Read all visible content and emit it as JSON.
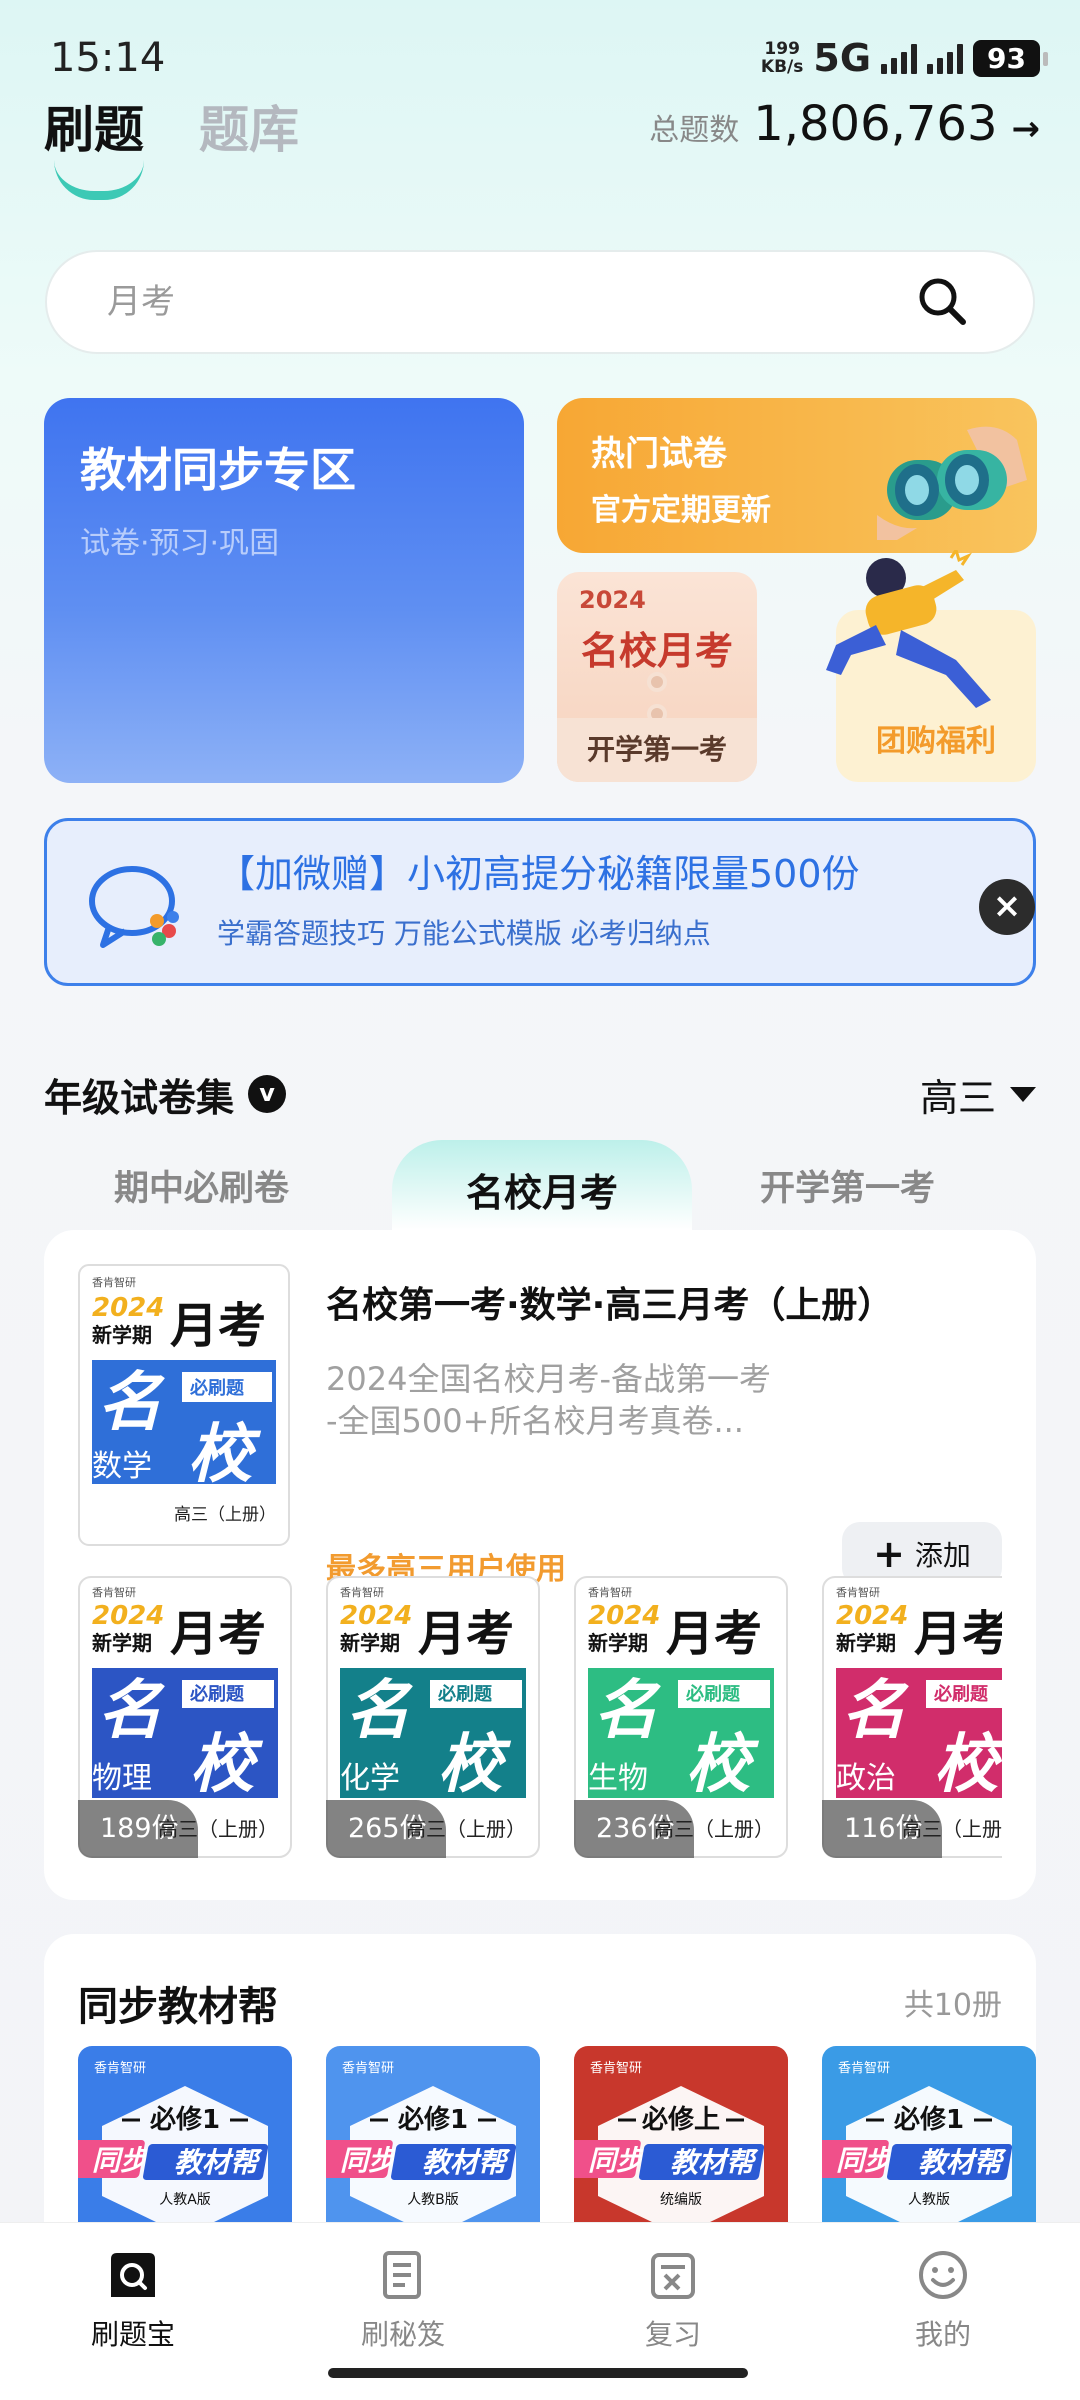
{
  "status_bar": {
    "time": "15:14",
    "net_speed_value": "199",
    "net_speed_unit": "KB/s",
    "network": "5G",
    "battery": "93"
  },
  "header": {
    "tab_active": "刷题",
    "tab_inactive": "题库",
    "total_label": "总题数",
    "total_value": "1,806,763",
    "arrow": "→"
  },
  "search": {
    "placeholder": "月考",
    "icon": "search-icon"
  },
  "features": {
    "sync": {
      "title": "教材同步专区",
      "subtitle": "试卷·预习·巩固"
    },
    "hot": {
      "title": "热门试卷",
      "subtitle": "官方定期更新"
    },
    "exam": {
      "year": "2024",
      "title": "名校月考",
      "bottom": "开学第一考"
    },
    "group": {
      "label": "团购福利"
    }
  },
  "promo": {
    "title": "【加微赠】小初高提分秘籍限量500份",
    "subtitle": "学霸答题技巧  万能公式模版  必考归纳点",
    "close": "×"
  },
  "grade_section": {
    "title": "年级试卷集",
    "badge": "v",
    "grade": "高三",
    "tabs": [
      "期中必刷卷",
      "名校月考",
      "开学第一考"
    ],
    "active_tab": 1,
    "featured": {
      "title": "名校第一考·数学·高三月考（上册）",
      "desc_line1": "2024全国名校月考-备战第一考",
      "desc_line2": "-全国500+所名校月考真卷...",
      "usage": "最多高三用户使用",
      "add_label": "添加",
      "add_icon": "+",
      "cover": {
        "brand": "香肯智研",
        "year": "2024",
        "term": "新学期",
        "kind": "月考",
        "big1": "名",
        "big2": "校",
        "stamp": "必刷题",
        "subject": "数学",
        "edition": "高三（上册）",
        "color": "#2f6fd8"
      }
    },
    "books": [
      {
        "subject": "物理",
        "count": "189份",
        "edition": "高三（上册）",
        "color": "#2c55c4"
      },
      {
        "subject": "化学",
        "count": "265份",
        "edition": "高三（上册）",
        "color": "#13808a"
      },
      {
        "subject": "生物",
        "count": "236份",
        "edition": "高三（上册）",
        "color": "#2dbd83"
      },
      {
        "subject": "政治",
        "count": "116份",
        "edition": "高三（上册）",
        "color": "#d12d6b"
      }
    ]
  },
  "textbook_section": {
    "title": "同步教材帮",
    "count": "共10册",
    "books": [
      {
        "brand": "香肯智研",
        "volume": "必修1",
        "tag1": "同步",
        "tag2": "教材帮",
        "edition": "人教A版",
        "color": "#3a7de8"
      },
      {
        "brand": "香肯智研",
        "volume": "必修1",
        "tag1": "同步",
        "tag2": "教材帮",
        "edition": "人教B版",
        "color": "#4f94ee"
      },
      {
        "brand": "香肯智研",
        "volume": "必修上",
        "tag1": "同步",
        "tag2": "教材帮",
        "edition": "统编版",
        "color": "#c8372c"
      },
      {
        "brand": "香肯智研",
        "volume": "必修1",
        "tag1": "同步",
        "tag2": "教材帮",
        "edition": "人教版",
        "color": "#3a9be6"
      }
    ]
  },
  "bottom_nav": [
    {
      "label": "刷题宝",
      "icon": "search-doc-icon",
      "active": true
    },
    {
      "label": "刷秘笈",
      "icon": "scroll-icon",
      "active": false
    },
    {
      "label": "复习",
      "icon": "review-book-icon",
      "active": false
    },
    {
      "label": "我的",
      "icon": "smile-icon",
      "active": false
    }
  ],
  "colors": {
    "accent": "#3cc9b5",
    "blue": "#3f74f0",
    "orange": "#f7a734",
    "promo_blue": "#3d80ea"
  }
}
